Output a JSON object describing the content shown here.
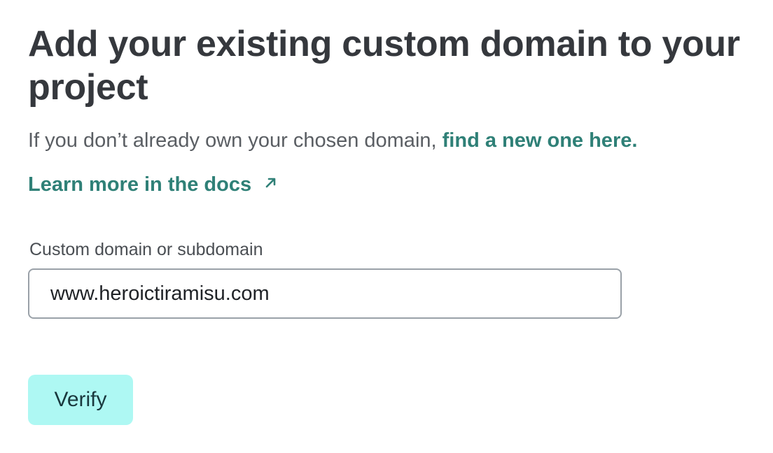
{
  "header": {
    "title": "Add your existing custom domain to your project"
  },
  "intro": {
    "text": "If you don’t already own your chosen domain, ",
    "link_label": "find a new one here."
  },
  "docs": {
    "link_label": "Learn more in the docs",
    "icon": "arrow-up-right-icon"
  },
  "form": {
    "domain_label": "Custom domain or subdomain",
    "domain_value": "www.heroictiramisu.com",
    "verify_label": "Verify"
  },
  "colors": {
    "link": "#2f8077",
    "button_bg": "#aef8f3",
    "title": "#35383d"
  }
}
